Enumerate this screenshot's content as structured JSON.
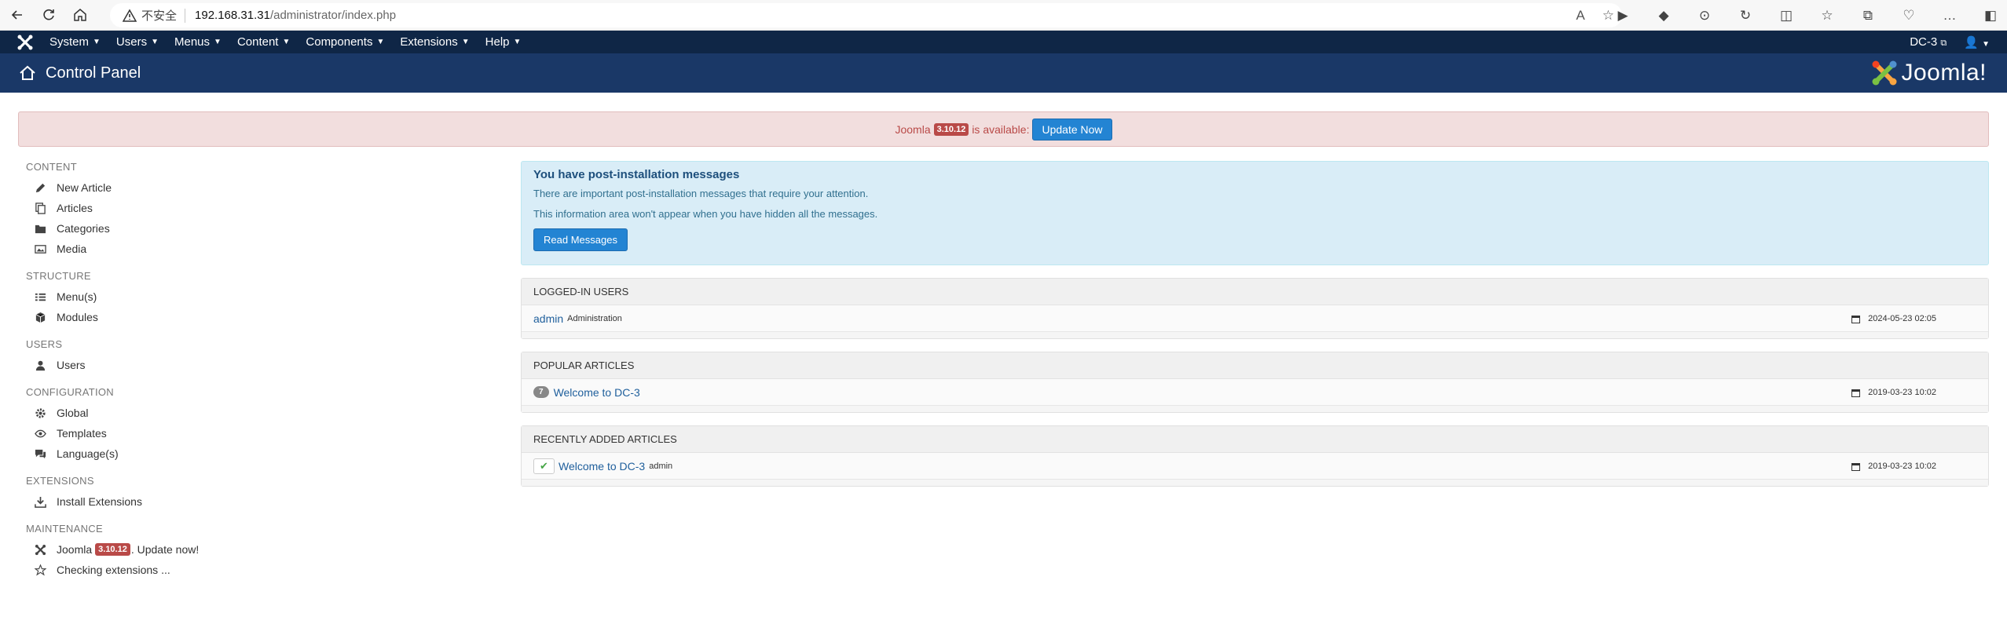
{
  "browser": {
    "insecure_label": "不安全",
    "url_host": "192.168.31.31",
    "url_path": "/administrator/index.php"
  },
  "topnav": {
    "menus": [
      {
        "label": "System"
      },
      {
        "label": "Users"
      },
      {
        "label": "Menus"
      },
      {
        "label": "Content"
      },
      {
        "label": "Components"
      },
      {
        "label": "Extensions"
      },
      {
        "label": "Help"
      }
    ],
    "site_name": "DC-3"
  },
  "header": {
    "title": "Control Panel",
    "logo_text": "Joomla!"
  },
  "alert": {
    "prefix": "Joomla",
    "version": "3.10.12",
    "suffix": "is available:",
    "button": "Update Now"
  },
  "sidebar": {
    "sections": [
      {
        "heading": "CONTENT",
        "items": [
          {
            "label": "New Article",
            "icon": "pencil-icon"
          },
          {
            "label": "Articles",
            "icon": "copy-icon"
          },
          {
            "label": "Categories",
            "icon": "folder-icon"
          },
          {
            "label": "Media",
            "icon": "image-icon"
          }
        ]
      },
      {
        "heading": "STRUCTURE",
        "items": [
          {
            "label": "Menu(s)",
            "icon": "list-icon"
          },
          {
            "label": "Modules",
            "icon": "cube-icon"
          }
        ]
      },
      {
        "heading": "USERS",
        "items": [
          {
            "label": "Users",
            "icon": "user-icon"
          }
        ]
      },
      {
        "heading": "CONFIGURATION",
        "items": [
          {
            "label": "Global",
            "icon": "gear-icon"
          },
          {
            "label": "Templates",
            "icon": "eye-icon"
          },
          {
            "label": "Language(s)",
            "icon": "comments-icon"
          }
        ]
      },
      {
        "heading": "EXTENSIONS",
        "items": [
          {
            "label": "Install Extensions",
            "icon": "download-icon"
          }
        ]
      },
      {
        "heading": "MAINTENANCE"
      }
    ],
    "maintenance": {
      "joomla_label": "Joomla",
      "version": "3.10.12",
      "update_text": ". Update now!",
      "checking_text": "Checking extensions ..."
    }
  },
  "post_install": {
    "title": "You have post-installation messages",
    "line1": "There are important post-installation messages that require your attention.",
    "line2": "This information area won't appear when you have hidden all the messages.",
    "button": "Read Messages"
  },
  "logged_in": {
    "heading": "LOGGED-IN USERS",
    "rows": [
      {
        "name": "admin",
        "role": "Administration",
        "date": "2024-05-23 02:05"
      }
    ]
  },
  "popular": {
    "heading": "POPULAR ARTICLES",
    "rows": [
      {
        "hits": "7",
        "title": "Welcome to DC-3",
        "date": "2019-03-23 10:02"
      }
    ]
  },
  "recent": {
    "heading": "RECENTLY ADDED ARTICLES",
    "rows": [
      {
        "title": "Welcome to DC-3",
        "author": "admin",
        "date": "2019-03-23 10:02"
      }
    ]
  },
  "colors": {
    "topnav_bg": "#0f2646",
    "header_bg": "#1a3867",
    "alert_bg": "#f2dede",
    "info_bg": "#d9edf7",
    "button_blue": "#2384d3",
    "badge_red": "#b94a48"
  }
}
